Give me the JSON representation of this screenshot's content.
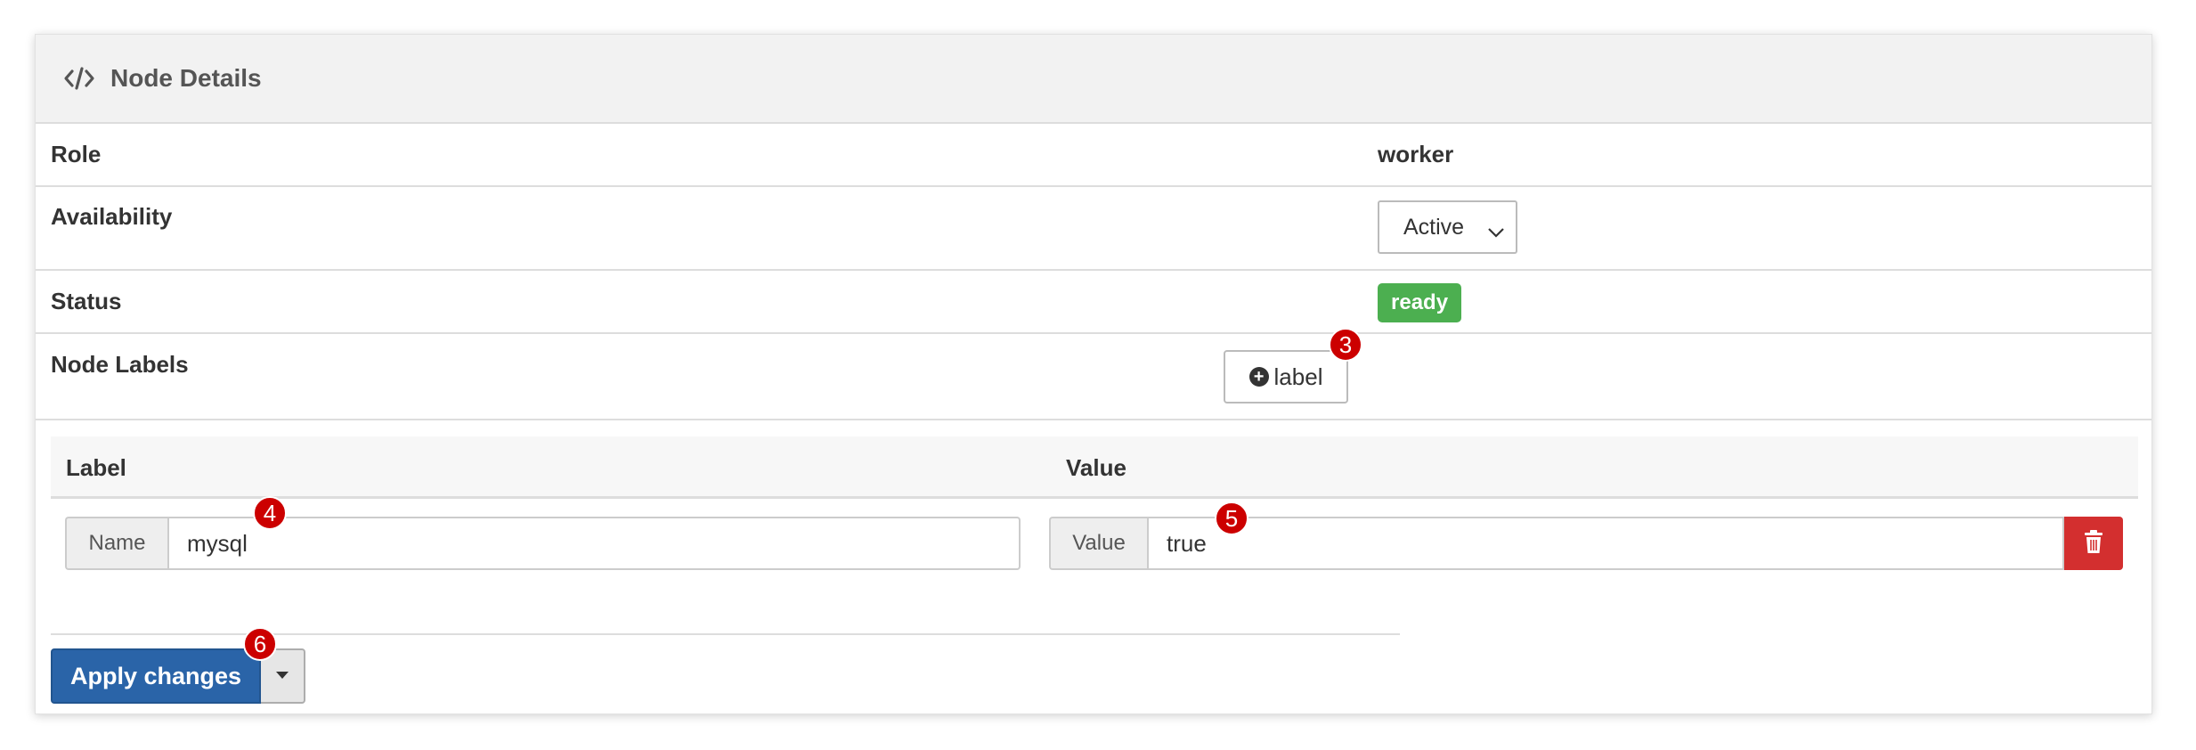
{
  "panel": {
    "title": "Node Details",
    "icon": "code-icon"
  },
  "details": {
    "role": {
      "label": "Role",
      "value": "worker"
    },
    "availability": {
      "label": "Availability",
      "selected": "Active"
    },
    "status": {
      "label": "Status",
      "value": "ready",
      "color": "#4caf50"
    },
    "node_labels": {
      "label": "Node Labels",
      "add_button_label": "label"
    }
  },
  "labels_table": {
    "headers": [
      "Label",
      "Value"
    ],
    "rows": [
      {
        "name_addon": "Name",
        "name": "mysql",
        "value_addon": "Value",
        "value": "true"
      }
    ]
  },
  "actions": {
    "apply_label": "Apply changes",
    "accent": "#2a64a8",
    "danger": "#d32f2f"
  },
  "markers": {
    "m3": "3",
    "m4": "4",
    "m5": "5",
    "m6": "6"
  }
}
